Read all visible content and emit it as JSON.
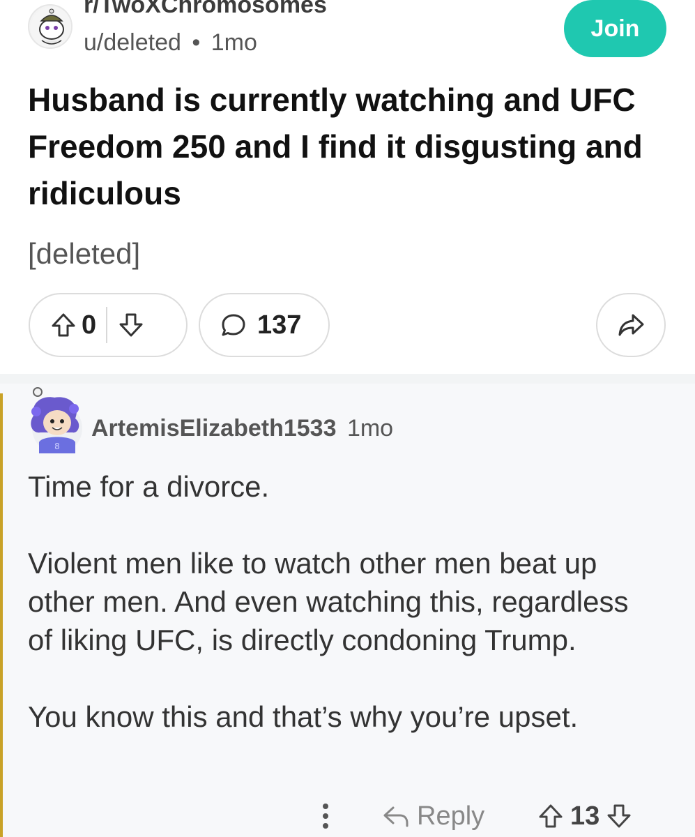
{
  "post": {
    "subreddit": "r/TwoXChromosomes",
    "author": "u/deleted",
    "separator": "•",
    "age": "1mo",
    "join_label": "Join",
    "title": "Husband is currently watching and UFC Freedom 250 and I find it disgusting and ridiculous",
    "body": "[deleted]",
    "score": "0",
    "comment_count": "137"
  },
  "comment": {
    "author": "ArtemisElizabeth1533",
    "age": "1mo",
    "paragraphs": [
      "Time for a divorce.",
      "Violent men like to watch other men beat up other men. And even watching this, regardless of liking UFC, is directly condoning Trump.",
      "You know this and that’s why you’re upset."
    ],
    "reply_label": "Reply",
    "score": "13"
  },
  "colors": {
    "join_button": "#1fc8b0",
    "thread_line": "#c9a227",
    "comment_background": "#f7f8fa"
  },
  "icons": [
    "subreddit-avatar-icon",
    "upvote-icon",
    "downvote-icon",
    "comment-icon",
    "share-icon",
    "user-avatar-icon",
    "more-options-icon",
    "reply-icon"
  ]
}
